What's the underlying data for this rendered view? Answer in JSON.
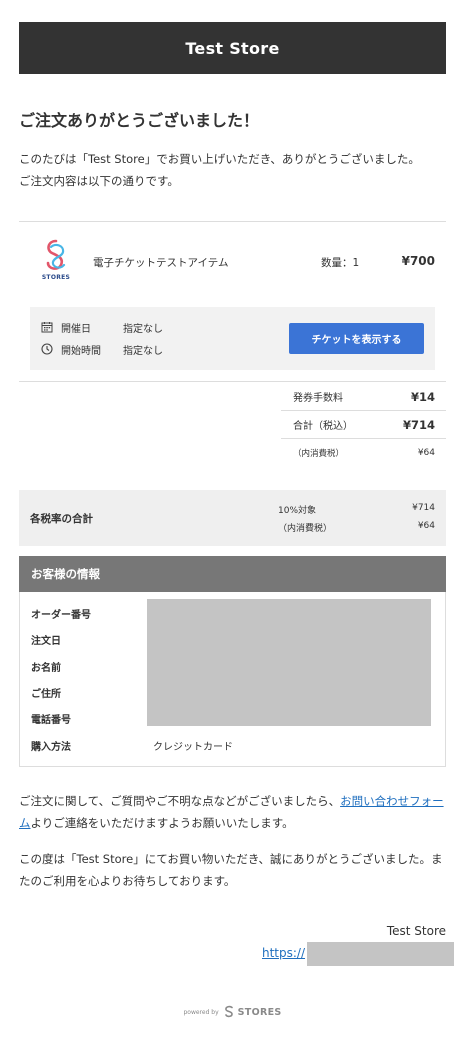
{
  "header": {
    "store_name": "Test Store"
  },
  "thanks": {
    "title": "ご注文ありがとうございました！",
    "line1": "このたびは「Test Store」でお買い上げいただき、ありがとうございました。",
    "line2": "ご注文内容は以下の通りです。"
  },
  "item": {
    "logo_text": "STORES",
    "name": "電子チケットテストアイテム",
    "quantity": "数量：1",
    "price": "¥700"
  },
  "event": {
    "date_label": "開催日",
    "date_value": "指定なし",
    "time_label": "開始時間",
    "time_value": "指定なし",
    "ticket_button": "チケットを表示する"
  },
  "fees": {
    "issue_fee_label": "発券手数料",
    "issue_fee_value": "¥14",
    "total_label": "合計（税込）",
    "total_value": "¥714",
    "tax_label": "（内消費税）",
    "tax_value": "¥64"
  },
  "tax_summary": {
    "label": "各税率の合計",
    "rate_label": "10%対象",
    "rate_value": "¥714",
    "tax_label": "（内消費税）",
    "tax_value": "¥64"
  },
  "customer": {
    "heading": "お客様の情報",
    "order_number_label": "オーダー番号",
    "order_date_label": "注文日",
    "name_label": "お名前",
    "address_label": "ご住所",
    "phone_label": "電話番号",
    "payment_label": "購入方法",
    "payment_value": "クレジットカード"
  },
  "contact": {
    "text_before": "ご注文に関して、ご質問やご不明な点などがございましたら、",
    "link_text": "お問い合わせフォーム",
    "text_after": "よりご連絡をいただけますようお願いいたします。"
  },
  "closing": {
    "text": "この度は「Test Store」にてお買い物いただき、誠にありがとうございました。またのご利用を心よりお待ちしております。"
  },
  "signature": {
    "store_name": "Test Store",
    "url_prefix": "https://"
  },
  "footer": {
    "powered_by": "powered by",
    "brand": "STORES"
  },
  "colors": {
    "header_bg": "#333333",
    "button_blue": "#3b74d6",
    "link_blue": "#1f6fbf",
    "customer_header_bg": "#777777",
    "redaction_gray": "#c4c4c4"
  }
}
